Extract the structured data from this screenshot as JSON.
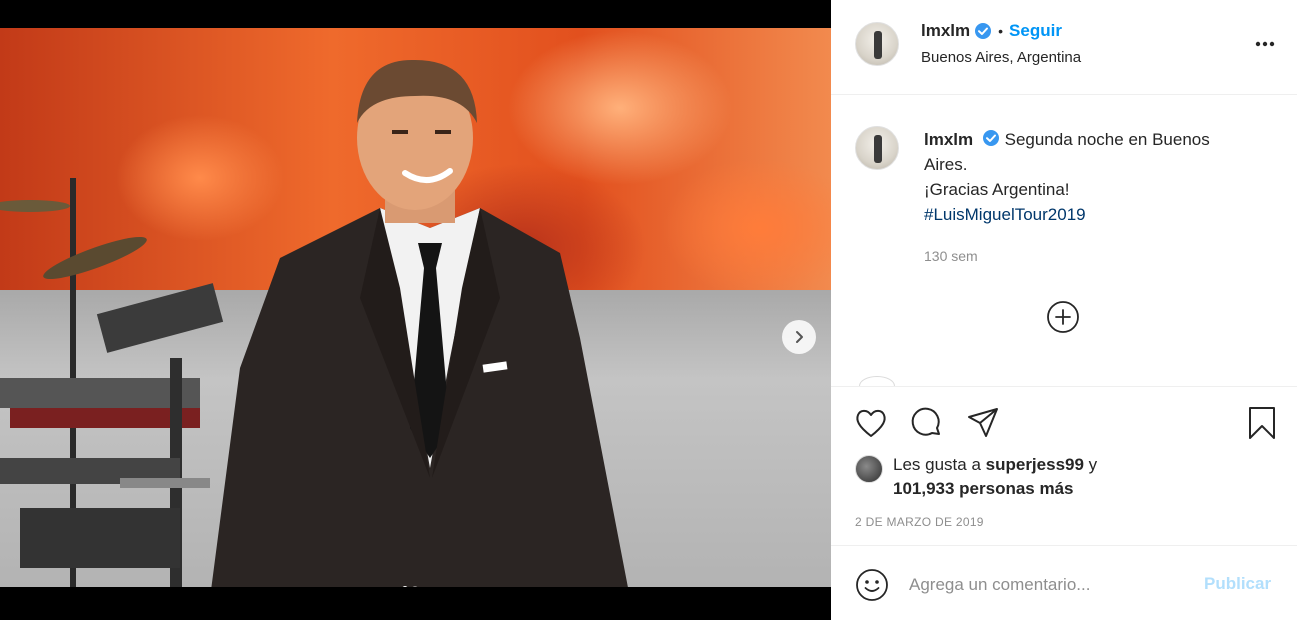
{
  "post": {
    "username": "lmxlm",
    "follow_label": "Seguir",
    "separator": "•",
    "location": "Buenos Aires, Argentina",
    "verified_icon": "verified-badge-icon",
    "more_icon": "more-options-icon"
  },
  "caption": {
    "username": "lmxlm",
    "line1": "Segunda noche en Buenos Aires.",
    "line2": "¡Gracias Argentina!",
    "hashtag": "#LuisMiguelTour2019",
    "time": "130 sem"
  },
  "load_more_icon": "plus-circle-icon",
  "actions": {
    "icons": [
      "heart-icon",
      "comment-icon",
      "share-icon",
      "bookmark-icon"
    ]
  },
  "likes": {
    "prefix": "Les gusta a",
    "user": "superjess99",
    "conj": "y",
    "count_text": "101,933 personas más"
  },
  "date": "2 DE MARZO DE 2019",
  "comment_box": {
    "placeholder": "Agrega un comentario...",
    "publish_label": "Publicar",
    "emoji_icon": "emoji-icon"
  },
  "carousel": {
    "current": 1,
    "total": 2,
    "next_icon": "chevron-right-icon"
  },
  "colors": {
    "accent": "#0095f6",
    "hashtag": "#00376b",
    "publish_disabled": "#b2dffc",
    "muted": "#8e8e8e"
  }
}
